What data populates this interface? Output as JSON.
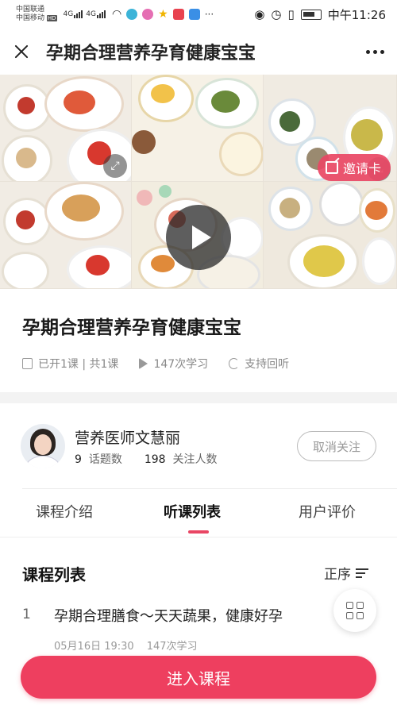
{
  "status_bar": {
    "carrier_1": "中国联通",
    "carrier_2": "中国移动",
    "hd_badge": "HD",
    "network_1": "4G",
    "network_2": "4G",
    "time": "中午11:26"
  },
  "header": {
    "title": "孕期合理营养孕育健康宝宝"
  },
  "banner": {
    "invite_label": "邀请卡"
  },
  "course": {
    "title": "孕期合理营养孕育健康宝宝",
    "lessons_info": "已开1课 | 共1课",
    "views": "147次学习",
    "replay": "支持回听"
  },
  "teacher": {
    "name": "营养医师文慧丽",
    "topics_count": "9",
    "topics_label": "话题数",
    "followers_count": "198",
    "followers_label": "关注人数",
    "unfollow_label": "取消关注"
  },
  "tabs": [
    {
      "label": "课程介绍"
    },
    {
      "label": "听课列表"
    },
    {
      "label": "用户评价"
    }
  ],
  "active_tab": "听课列表",
  "lesson_list": {
    "title": "课程列表",
    "sort_label": "正序",
    "items": [
      {
        "index": "1",
        "title": "孕期合理膳食～天天蔬果，健康好孕",
        "date": "05月16日 19:30",
        "views": "147次学习"
      }
    ]
  },
  "footer": {
    "enter_label": "进入课程"
  },
  "colors": {
    "accent": "#ee3f5f",
    "invite_bg": "#e94664",
    "divider": "#f3f3f3"
  }
}
